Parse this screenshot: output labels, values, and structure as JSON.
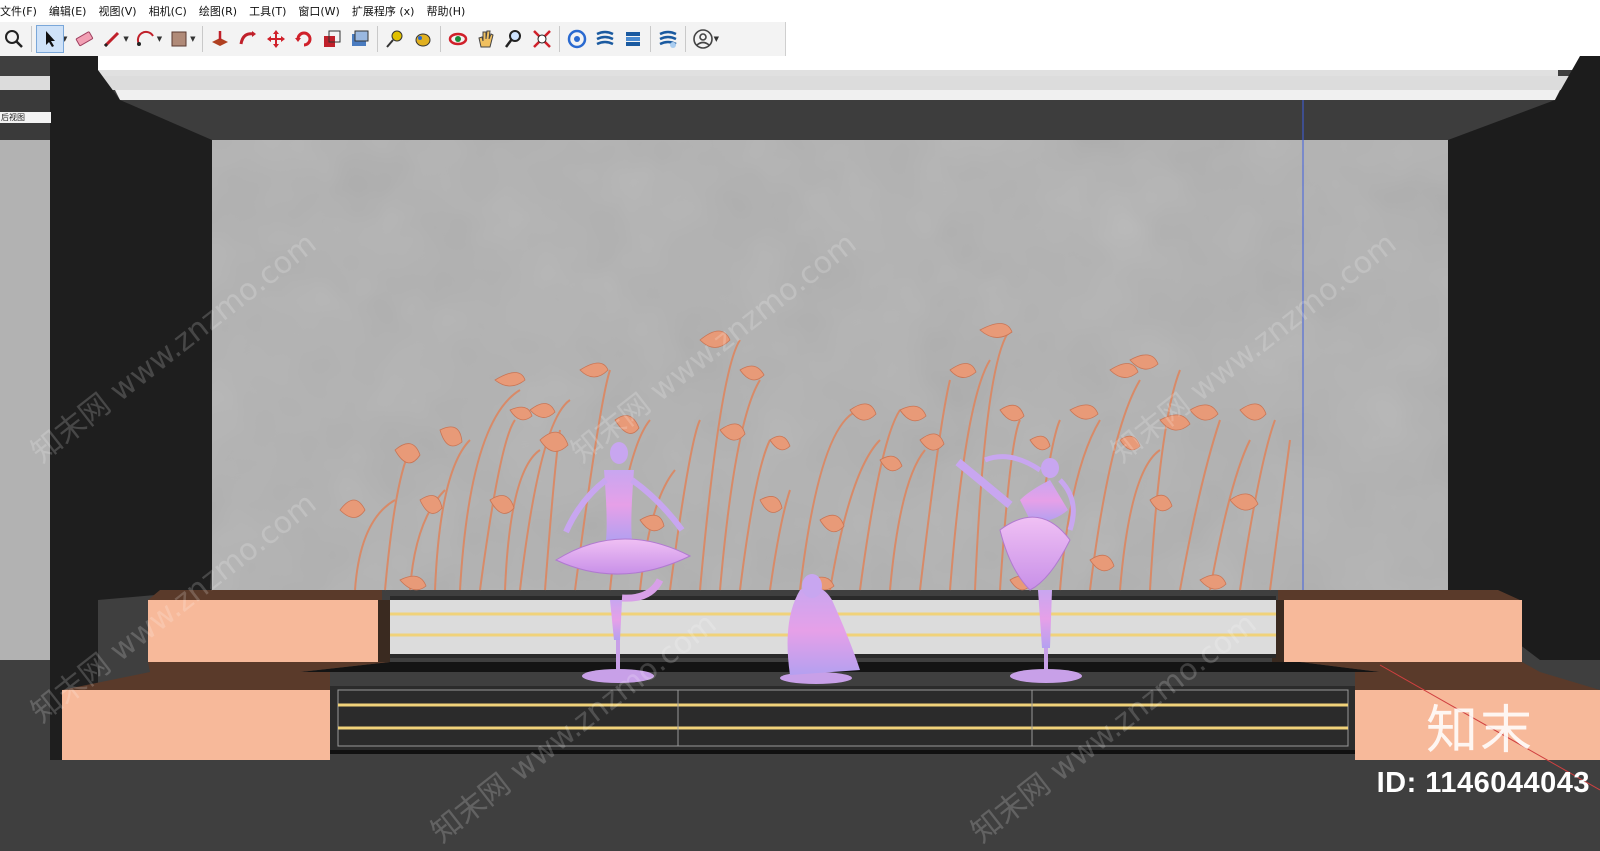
{
  "menu": [
    {
      "label": "文件(F)"
    },
    {
      "label": "编辑(E)"
    },
    {
      "label": "视图(V)"
    },
    {
      "label": "相机(C)"
    },
    {
      "label": "绘图(R)"
    },
    {
      "label": "工具(T)"
    },
    {
      "label": "窗口(W)"
    },
    {
      "label": "扩展程序 (x)"
    },
    {
      "label": "帮助(H)"
    }
  ],
  "viewport_tab": "后视图",
  "watermark": {
    "logo": "知末",
    "id_text": "ID: 1146044043",
    "site": "知末网 www.znzmo.com"
  },
  "colors": {
    "wall": "#b2b2b2",
    "frame": "#1e1e1e",
    "platform": "#f7b99a",
    "leaf": "#e89a78",
    "dancer": "#d69ae6",
    "floor": "#3f3f3f"
  },
  "toolbar_icons": [
    "zoom-extents-icon",
    "select-icon",
    "eraser-icon",
    "pencil-icon",
    "arc-icon",
    "shape-icon",
    "push-pull-icon",
    "follow-me-icon",
    "move-icon",
    "rotate-icon",
    "scale-icon",
    "offset-icon",
    "tape-measure-icon",
    "paint-bucket-icon",
    "orbit-icon",
    "pan-icon",
    "zoom-icon",
    "zoom-window-icon",
    "components-icon",
    "layers-icon",
    "styles-icon",
    "scenes-icon",
    "account-icon"
  ]
}
